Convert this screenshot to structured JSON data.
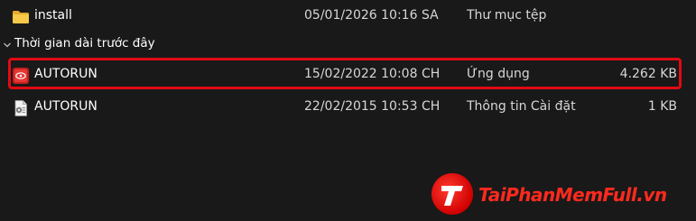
{
  "files": [
    {
      "name": "install",
      "date": "05/01/2026 10:16 SA",
      "type": "Thư mục tệp",
      "size": "",
      "icon": "folder-icon",
      "icon_color": "#f2c14e"
    },
    {
      "name": "AUTORUN",
      "date": "15/02/2022 10:08 CH",
      "type": "Ứng dụng",
      "size": "4.262 KB",
      "icon": "autorun-app-icon",
      "icon_color": "#d62828",
      "highlighted": true,
      "highlight_color": "#e10a14"
    },
    {
      "name": "AUTORUN",
      "date": "22/02/2015 10:53 CH",
      "type": "Thông tin Cài đặt",
      "size": "1 KB",
      "icon": "setup-info-file-icon"
    }
  ],
  "group": {
    "label": "Thời gian dài trước đây",
    "icon": "chevron-down-icon"
  },
  "watermark": {
    "text": "TaiPhanMemFull.vn",
    "color": "#ff2a1e"
  }
}
